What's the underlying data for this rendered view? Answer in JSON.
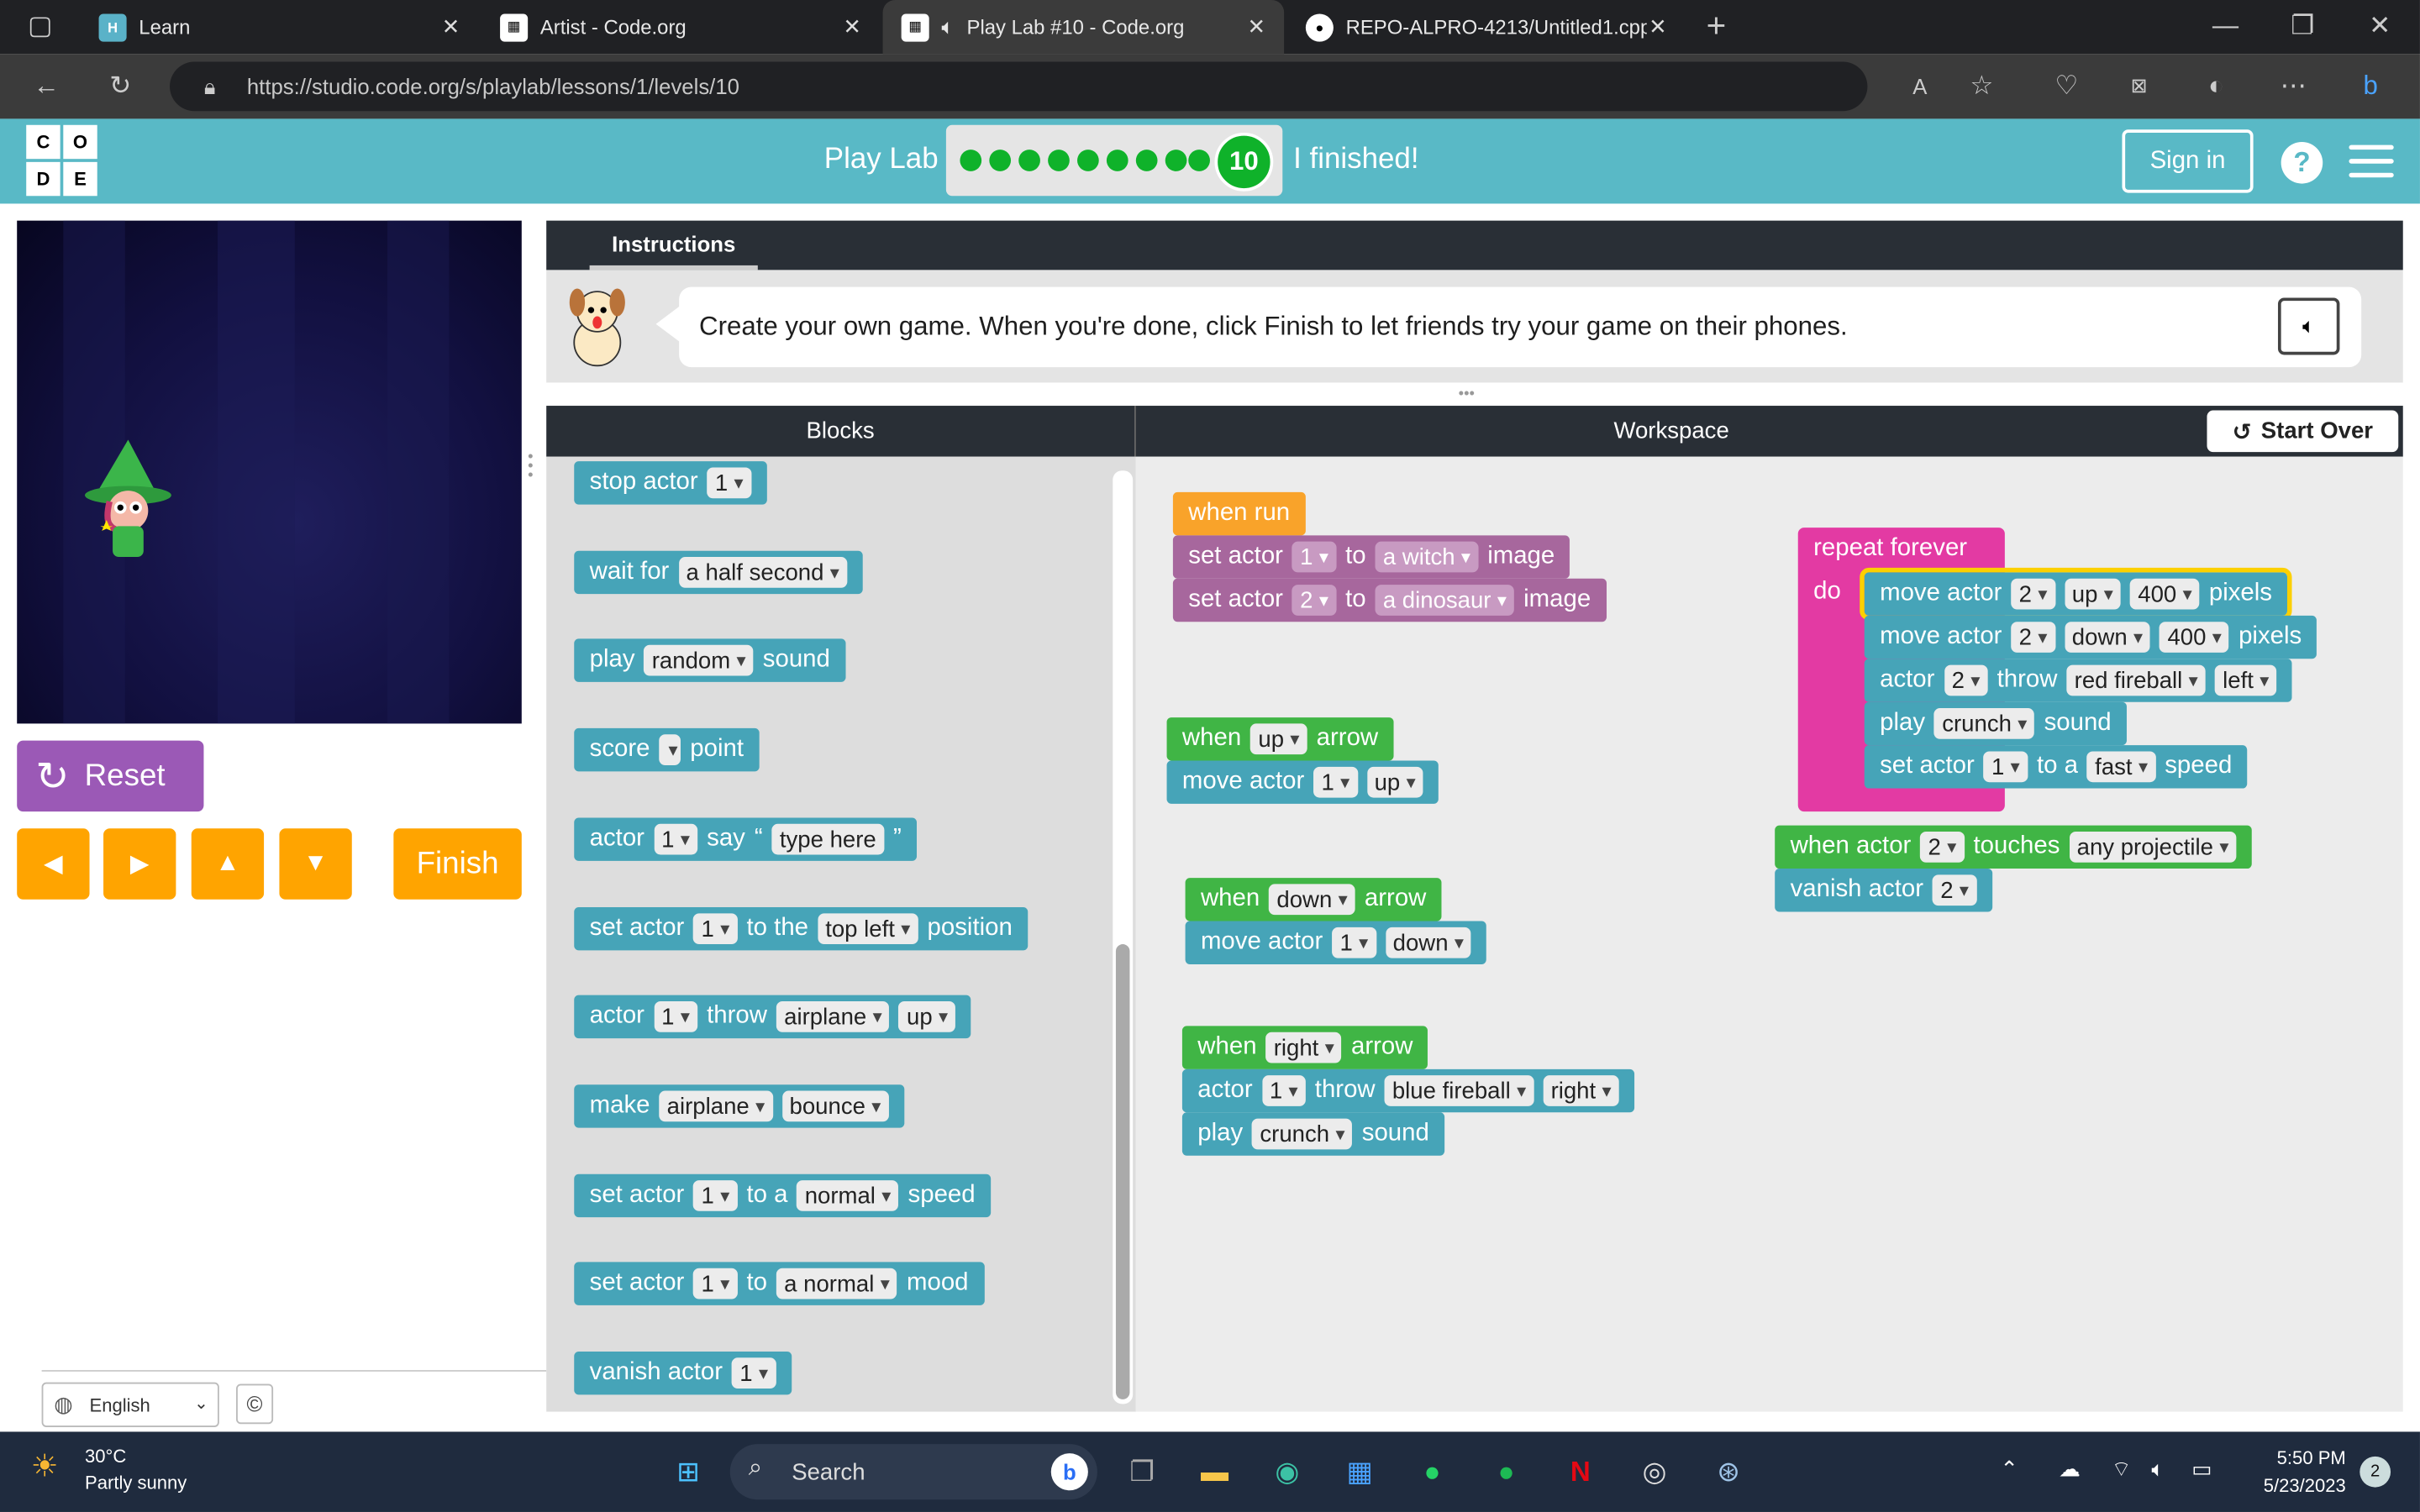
{
  "browser": {
    "tabs": [
      {
        "title": "Learn",
        "icon": "hour-of-code"
      },
      {
        "title": "Artist - Code.org",
        "icon": "code-org"
      },
      {
        "title": "Play Lab #10 - Code.org",
        "icon": "code-org"
      },
      {
        "title": "REPO-ALPRO-4213/Untitled1.cpp",
        "icon": "github"
      }
    ],
    "url": "https://studio.code.org/s/playlab/lessons/1/levels/10"
  },
  "header": {
    "logo_letters": [
      "C",
      "O",
      "D",
      "E"
    ],
    "lesson_title": "Play Lab",
    "current_level": "10",
    "finished_label": "I finished!",
    "sign_in": "Sign in",
    "help": "?"
  },
  "left": {
    "reset": "Reset",
    "finish": "Finish",
    "language": "English",
    "copyright": "©"
  },
  "instructions": {
    "tab": "Instructions",
    "text": "Create your own game. When you're done, click Finish to let friends try your game on their phones."
  },
  "editor": {
    "blocks_title": "Blocks",
    "workspace_title": "Workspace",
    "start_over": "Start Over"
  },
  "toolbox_blocks": [
    {
      "text": "stop actor",
      "f1": "1"
    },
    {
      "text": "wait for",
      "f1": "a half second"
    },
    {
      "text": "play",
      "f1": "random",
      "t2": "sound"
    },
    {
      "text": "score",
      "f1": "",
      "t2": "point"
    },
    {
      "text": "actor",
      "f1": "1",
      "t2": "say",
      "f2": "type here"
    },
    {
      "text": "set actor",
      "f1": "1",
      "t2": "to the",
      "f2": "top left",
      "t3": "position"
    },
    {
      "text": "actor",
      "f1": "1",
      "t2": "throw",
      "f2": "airplane",
      "f3": "up"
    },
    {
      "text": "make",
      "f1": "airplane",
      "f2": "bounce"
    },
    {
      "text": "set actor",
      "f1": "1",
      "t2": "to a",
      "f2": "normal",
      "t3": "speed"
    },
    {
      "text": "set actor",
      "f1": "1",
      "t2": "to",
      "f2": "a normal",
      "t3": "mood"
    },
    {
      "text": "vanish actor",
      "f1": "1"
    }
  ],
  "workspace": {
    "when_run": "when run",
    "set1": {
      "a": "set actor",
      "n": "1",
      "b": "to",
      "v": "a witch",
      "c": "image"
    },
    "set2": {
      "a": "set actor",
      "n": "2",
      "b": "to",
      "v": "a dinosaur",
      "c": "image"
    },
    "up_event": {
      "a": "when",
      "k": "up",
      "b": "arrow"
    },
    "up_move": {
      "a": "move actor",
      "n": "1",
      "d": "up"
    },
    "down_event": {
      "a": "when",
      "k": "down",
      "b": "arrow"
    },
    "down_move": {
      "a": "move actor",
      "n": "1",
      "d": "down"
    },
    "right_event": {
      "a": "when",
      "k": "right",
      "b": "arrow"
    },
    "right_throw": {
      "a": "actor",
      "n": "1",
      "b": "throw",
      "p": "blue fireball",
      "d": "right"
    },
    "right_play": {
      "a": "play",
      "s": "crunch",
      "b": "sound"
    },
    "repeat": {
      "label": "repeat forever",
      "do": "do"
    },
    "rep_move1": {
      "a": "move actor",
      "n": "2",
      "d": "up",
      "px": "400",
      "b": "pixels"
    },
    "rep_move2": {
      "a": "move actor",
      "n": "2",
      "d": "down",
      "px": "400",
      "b": "pixels"
    },
    "rep_throw": {
      "a": "actor",
      "n": "2",
      "b": "throw",
      "p": "red fireball",
      "d": "left"
    },
    "rep_play": {
      "a": "play",
      "s": "crunch",
      "b": "sound"
    },
    "rep_speed": {
      "a": "set actor",
      "n": "1",
      "b": "to a",
      "s": "fast",
      "c": "speed"
    },
    "touch_event": {
      "a": "when actor",
      "n": "2",
      "b": "touches",
      "t": "any projectile"
    },
    "vanish": {
      "a": "vanish actor",
      "n": "2"
    }
  },
  "taskbar": {
    "temperature": "30°C",
    "weather": "Partly sunny",
    "search": "Search",
    "time": "5:50 PM",
    "date": "5/23/2023",
    "notifications": "2"
  },
  "colors": {
    "brand": "#59b9c6",
    "progress": "#0fb22a",
    "button": "#ffa400",
    "reset": "#9b59b6"
  }
}
